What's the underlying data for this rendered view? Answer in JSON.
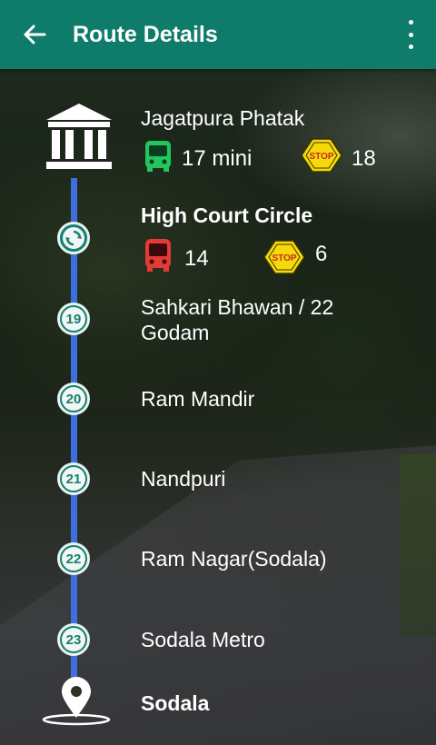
{
  "header": {
    "title": "Route Details"
  },
  "origin": {
    "name": "Jagatpura Phatak",
    "bus_type": "17 mini",
    "stop_sign": "STOP",
    "stop_count": "18"
  },
  "interchange": {
    "name": "High Court Circle",
    "bus_number": "14",
    "stop_sign": "STOP",
    "stop_count": "6"
  },
  "stops": [
    {
      "number": "19",
      "name": "Sahkari Bhawan / 22 Godam"
    },
    {
      "number": "20",
      "name": "Ram Mandir"
    },
    {
      "number": "21",
      "name": "Nandpuri"
    },
    {
      "number": "22",
      "name": "Ram Nagar(Sodala)"
    },
    {
      "number": "23",
      "name": "Sodala Metro"
    }
  ],
  "destination": {
    "name": "Sodala"
  },
  "colors": {
    "appbar": "#0f7c6b",
    "route_line": "#3d6fe0",
    "mini_bus": "#22c55e",
    "bus": "#e53935",
    "stop_sign": "#f5d90a"
  }
}
